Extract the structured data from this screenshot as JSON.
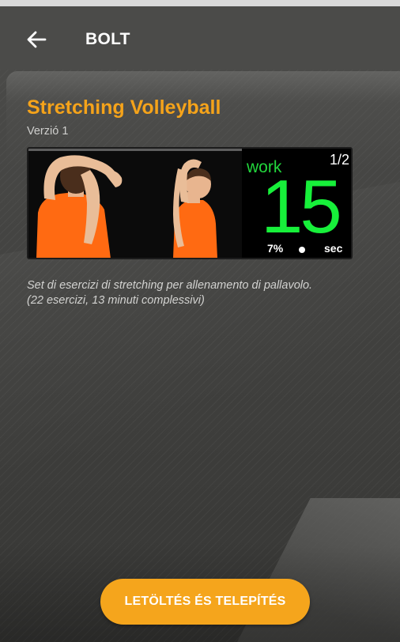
{
  "app_bar": {
    "back_icon": "arrow-left-icon",
    "title": "BOLT"
  },
  "program": {
    "title": "Stretching Volleyball",
    "version": "Verzió 1",
    "description_line1": "Set di esercizi di stretching per allenamento di pallavolo.",
    "description_line2": "(22 esercizi, 13 minuti complessivi)"
  },
  "preview": {
    "mode_label": "work",
    "round": "1/2",
    "seconds": "15",
    "progress": "7%",
    "unit": "sec"
  },
  "actions": {
    "install_label": "LETÖLTÉS ÉS TELEPÍTÉS"
  },
  "colors": {
    "accent": "#f5a51c",
    "timer_green": "#17f03a",
    "shirt_orange": "#ff6a12"
  }
}
